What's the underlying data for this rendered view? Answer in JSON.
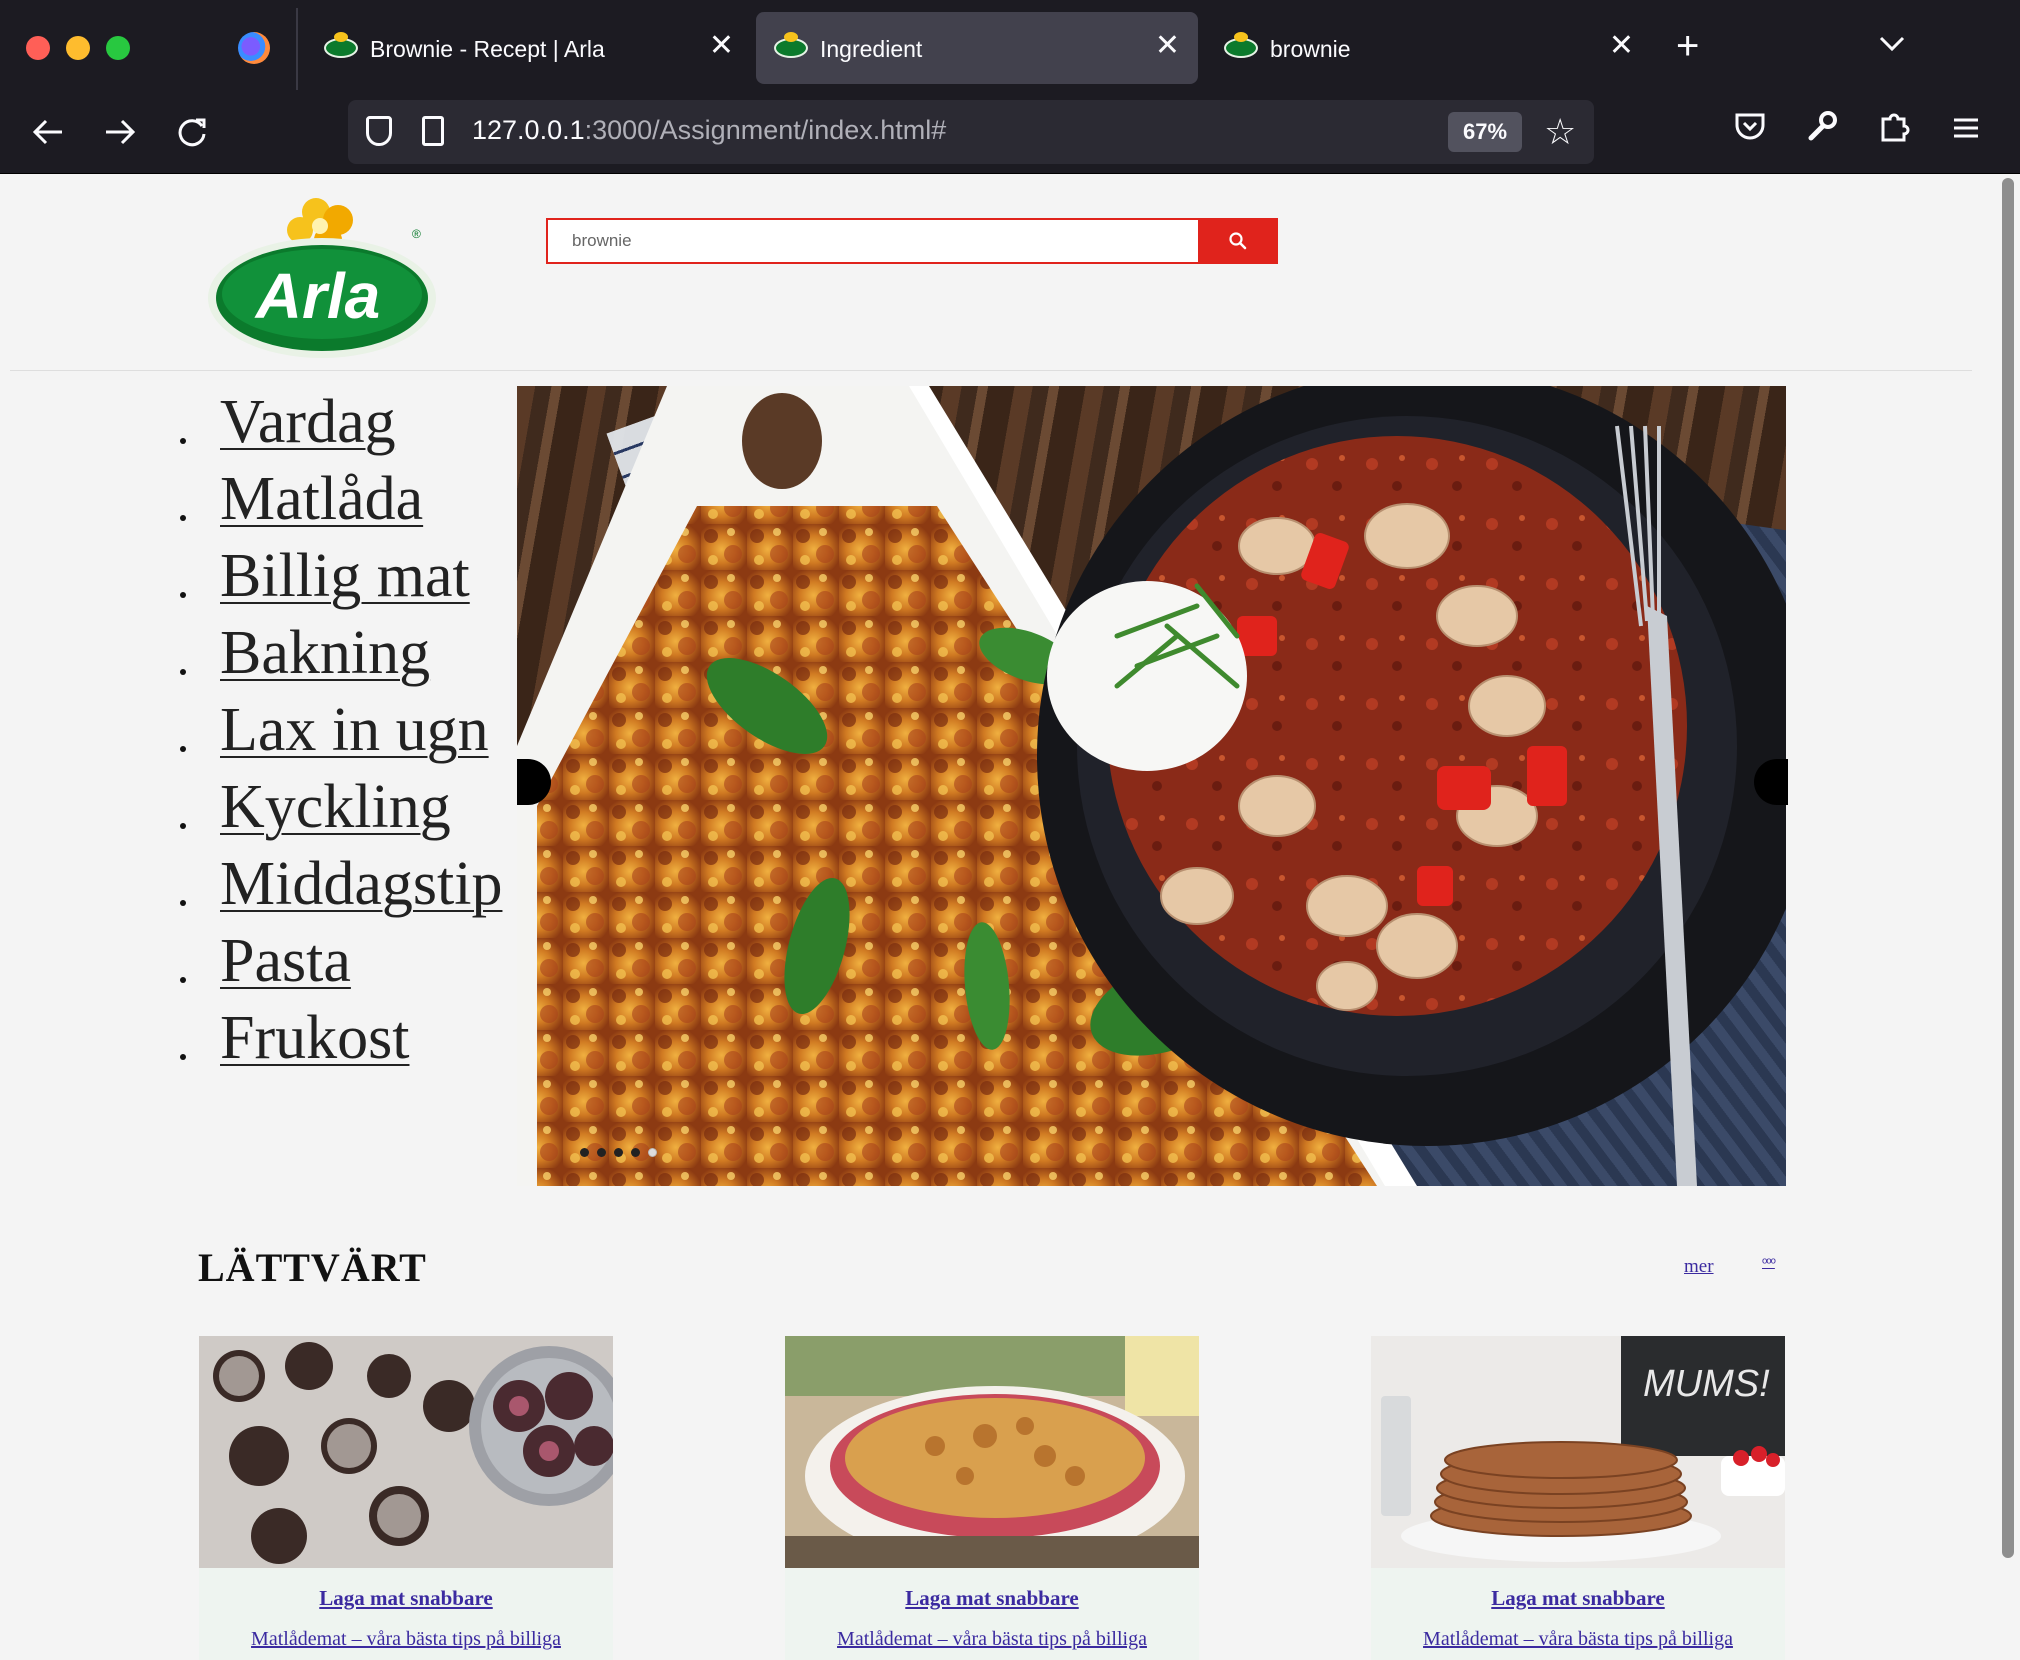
{
  "browser": {
    "tabs": [
      {
        "title": "Brownie - Recept | Arla",
        "active": false
      },
      {
        "title": "Ingredient",
        "active": true
      },
      {
        "title": "brownie",
        "active": false
      }
    ],
    "url_host": "127.0.0.1",
    "url_rest": ":3000/Assignment/index.html#",
    "zoom": "67%"
  },
  "colors": {
    "accent": "#e0231c",
    "link": "#3b2aa0",
    "brand_green": "#0b7a2c",
    "brand_yellow": "#f6c21c"
  },
  "header": {
    "logo_text": "Arla",
    "search_value": "brownie"
  },
  "categories": [
    "Vardag",
    "Matlåda",
    "Billig mat",
    "Bakning",
    "Lax in ugn",
    "Kyckling",
    "Middagstip",
    "Pasta",
    "Frukost"
  ],
  "carousel": {
    "slide_count": 5,
    "active_index": 4
  },
  "section": {
    "title": "LÄTTVÄRT",
    "more_label": "mer",
    "more_icon": "ᵒᵒᵒ"
  },
  "cards": [
    {
      "heading": "Laga mat snabbare",
      "description": "Matlådemat – våra bästa tips på billiga",
      "image": "chocolate-balls"
    },
    {
      "heading": "Laga mat snabbare",
      "description": "Matlådemat – våra bästa tips på billiga",
      "image": "rhubarb-crumble"
    },
    {
      "heading": "Laga mat snabbare",
      "description": "Matlådemat – våra bästa tips på billiga",
      "image": "pancakes"
    }
  ]
}
